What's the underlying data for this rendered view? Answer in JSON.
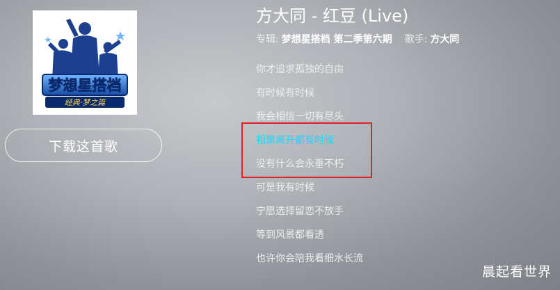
{
  "song": {
    "title": "方大同 - 红豆 (Live)",
    "album_label": "专辑:",
    "album": "梦想星搭档 第二季第六期",
    "singer_label": "歌手:",
    "singer": "方大同"
  },
  "cover": {
    "logo_text": "梦想星搭档",
    "logo_subtitle": "经典·梦之篇"
  },
  "download_button": "下载这首歌",
  "lyrics": [
    "你才追求孤独的自由",
    "有时候有时候",
    "我会相信一切有尽头",
    "相聚离开都有时候",
    "没有什么会永垂不朽",
    "可是我有时候",
    "宁愿选择留恋不放手",
    "等到风景都看透",
    "也许你会陪我看细水长流"
  ],
  "active_lyric_index": 3,
  "watermark": "晨起看世界",
  "colors": {
    "active_lyric": "#21d4ff",
    "highlight_box": "#e0212b"
  }
}
